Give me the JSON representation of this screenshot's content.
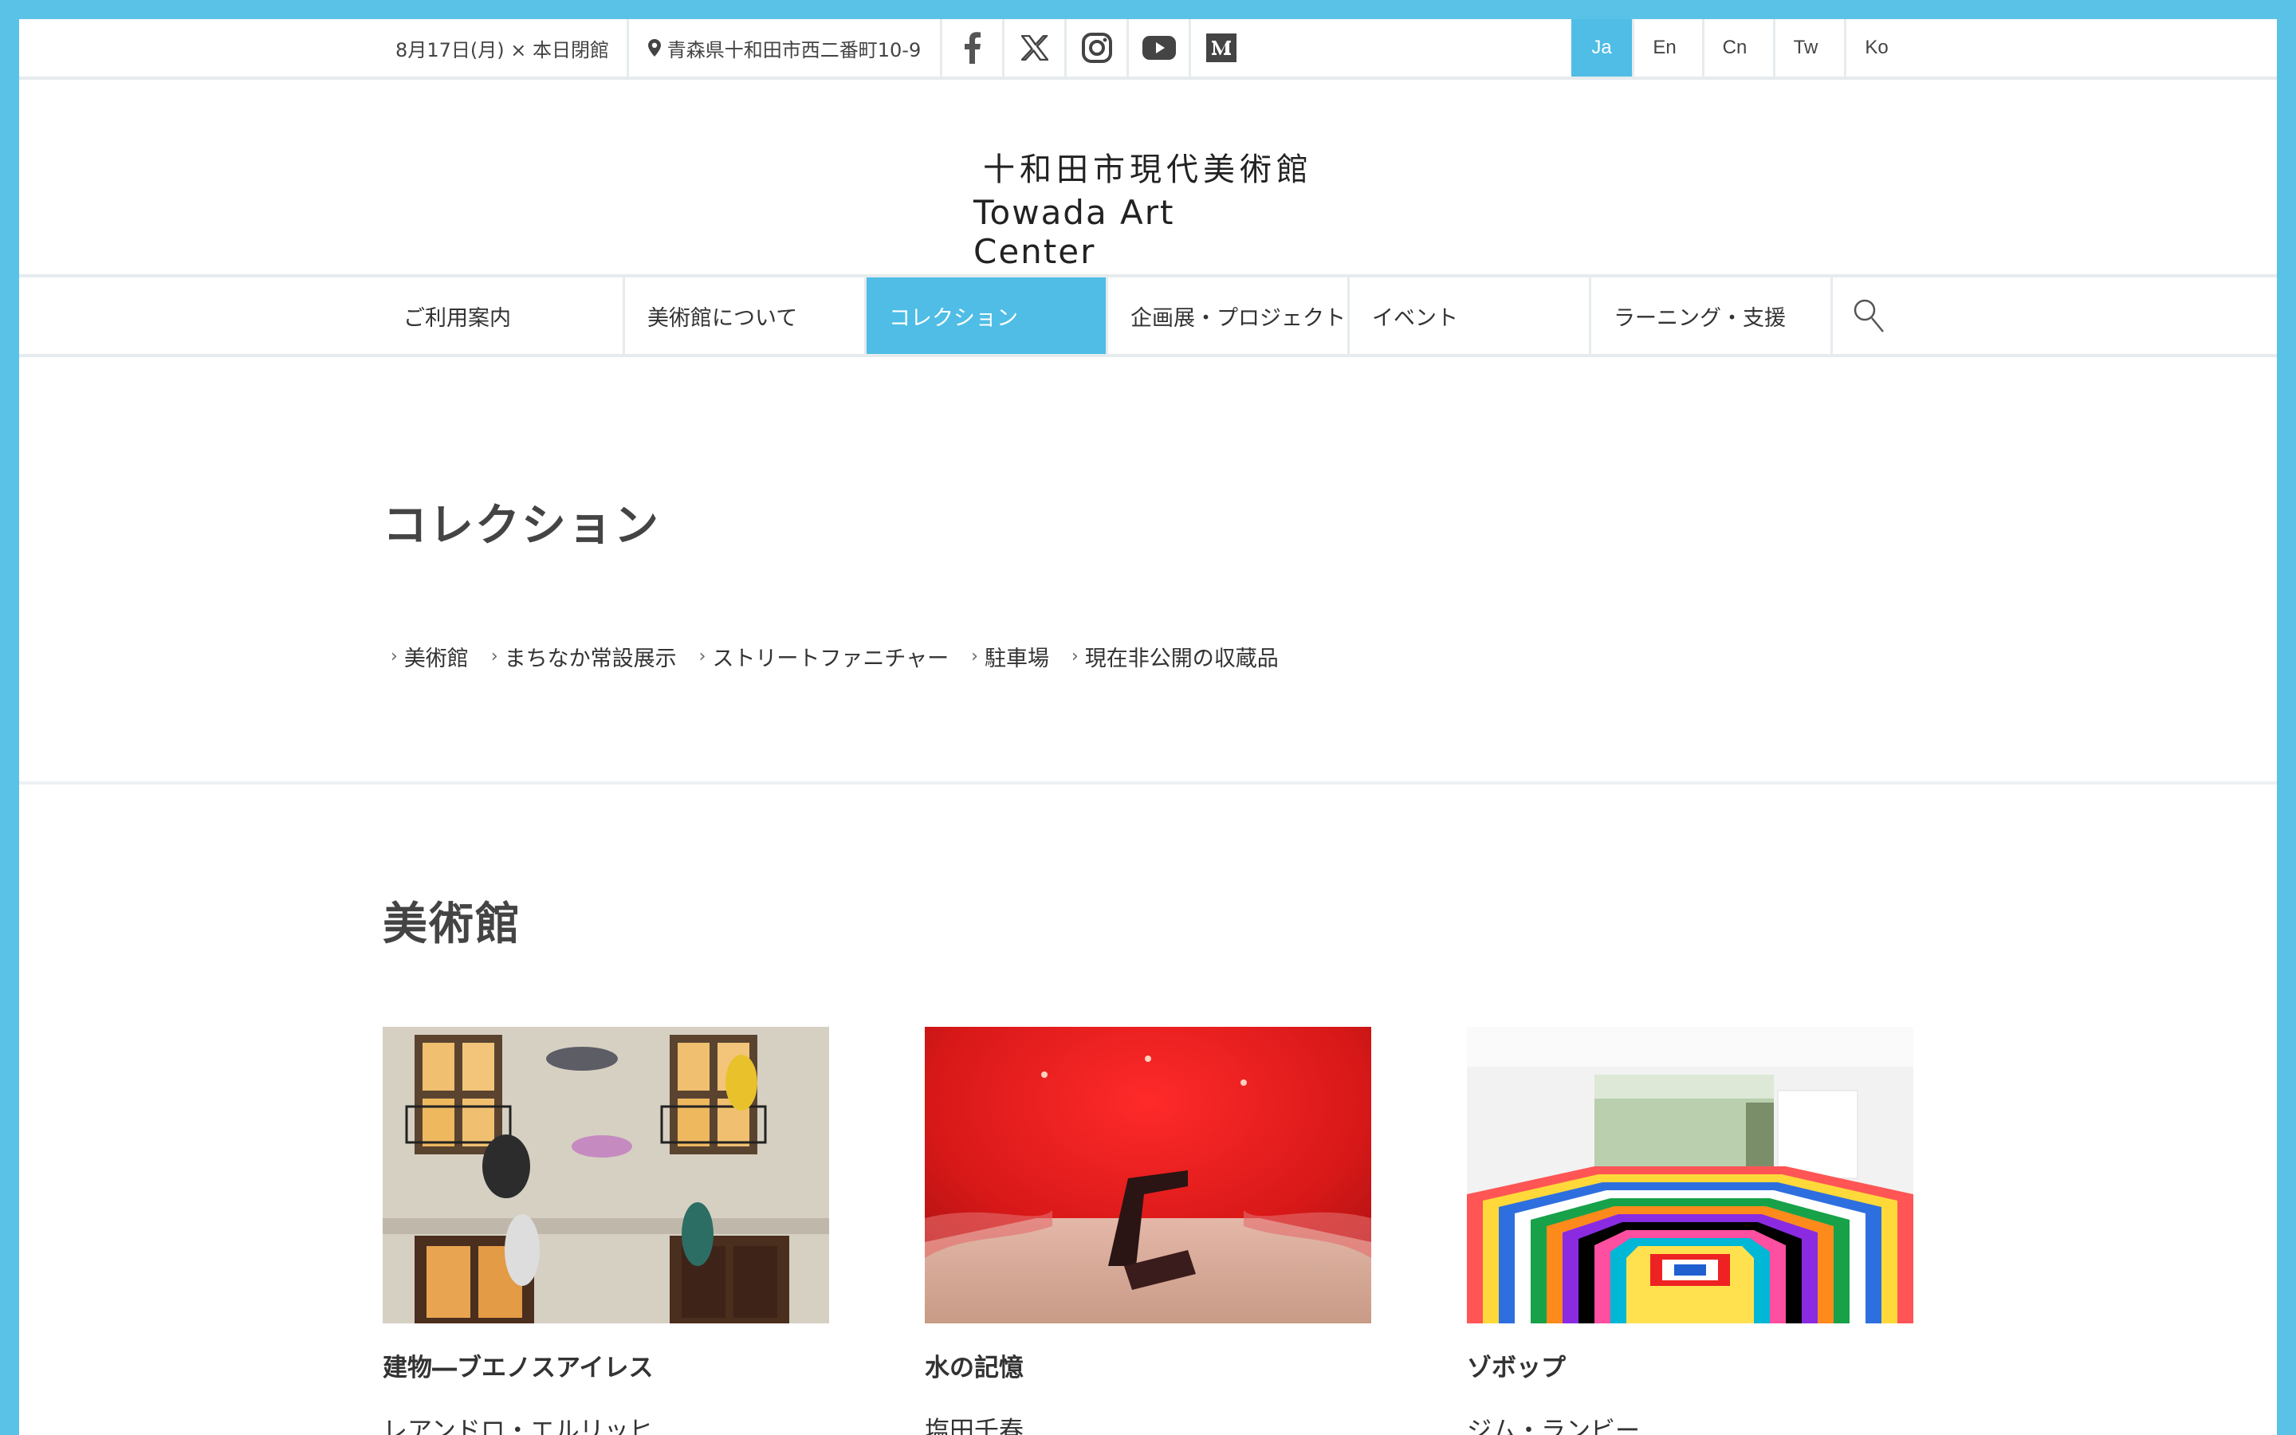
{
  "topbar": {
    "date": "8月17日(月) × 本日閉館",
    "address": "青森県十和田市西二番町10-9",
    "sns": [
      "facebook-icon",
      "x-icon",
      "instagram-icon",
      "youtube-icon",
      "medium-icon"
    ],
    "languages": [
      "Ja",
      "En",
      "Cn",
      "Tw",
      "Ko"
    ],
    "active_language": "Ja"
  },
  "logo": {
    "ja": "十和田市現代美術館",
    "en": "Towada Art Center"
  },
  "nav": {
    "items": [
      {
        "label": "ご利用案内"
      },
      {
        "label": "美術館について"
      },
      {
        "label": "コレクション",
        "active": true
      },
      {
        "label": "企画展・プロジェクト"
      },
      {
        "label": "イベント"
      },
      {
        "label": "ラーニング・支援"
      }
    ],
    "search_icon": "search-icon"
  },
  "page": {
    "title": "コレクション",
    "subnav": [
      "美術館",
      "まちなか常設展示",
      "ストリートファニチャー",
      "駐車場",
      "現在非公開の収蔵品"
    ]
  },
  "section": {
    "title": "美術館",
    "cards": [
      {
        "title": "建物―ブエノスアイレス",
        "artist": "レアンドロ・エルリッヒ"
      },
      {
        "title": "水の記憶",
        "artist": "塩田千春"
      },
      {
        "title": "ゾボップ",
        "artist": "ジム・ランビー"
      }
    ]
  },
  "colors": {
    "accent": "#4fbde5",
    "frame": "#5bc2e7",
    "divider": "#e6ebee"
  }
}
